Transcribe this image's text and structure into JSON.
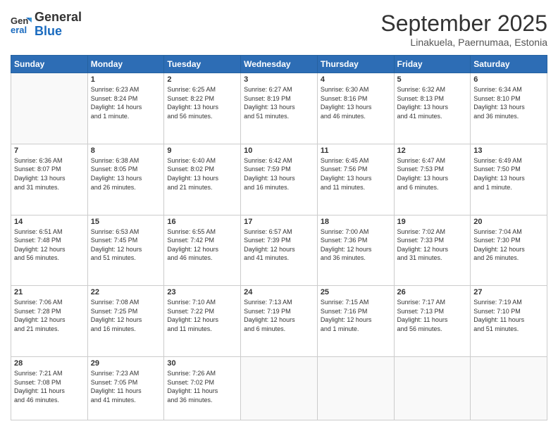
{
  "logo": {
    "line1": "General",
    "line2": "Blue"
  },
  "title": "September 2025",
  "subtitle": "Linakuela, Paernumaa, Estonia",
  "headers": [
    "Sunday",
    "Monday",
    "Tuesday",
    "Wednesday",
    "Thursday",
    "Friday",
    "Saturday"
  ],
  "weeks": [
    [
      {
        "day": "",
        "info": ""
      },
      {
        "day": "1",
        "info": "Sunrise: 6:23 AM\nSunset: 8:24 PM\nDaylight: 14 hours\nand 1 minute."
      },
      {
        "day": "2",
        "info": "Sunrise: 6:25 AM\nSunset: 8:22 PM\nDaylight: 13 hours\nand 56 minutes."
      },
      {
        "day": "3",
        "info": "Sunrise: 6:27 AM\nSunset: 8:19 PM\nDaylight: 13 hours\nand 51 minutes."
      },
      {
        "day": "4",
        "info": "Sunrise: 6:30 AM\nSunset: 8:16 PM\nDaylight: 13 hours\nand 46 minutes."
      },
      {
        "day": "5",
        "info": "Sunrise: 6:32 AM\nSunset: 8:13 PM\nDaylight: 13 hours\nand 41 minutes."
      },
      {
        "day": "6",
        "info": "Sunrise: 6:34 AM\nSunset: 8:10 PM\nDaylight: 13 hours\nand 36 minutes."
      }
    ],
    [
      {
        "day": "7",
        "info": "Sunrise: 6:36 AM\nSunset: 8:07 PM\nDaylight: 13 hours\nand 31 minutes."
      },
      {
        "day": "8",
        "info": "Sunrise: 6:38 AM\nSunset: 8:05 PM\nDaylight: 13 hours\nand 26 minutes."
      },
      {
        "day": "9",
        "info": "Sunrise: 6:40 AM\nSunset: 8:02 PM\nDaylight: 13 hours\nand 21 minutes."
      },
      {
        "day": "10",
        "info": "Sunrise: 6:42 AM\nSunset: 7:59 PM\nDaylight: 13 hours\nand 16 minutes."
      },
      {
        "day": "11",
        "info": "Sunrise: 6:45 AM\nSunset: 7:56 PM\nDaylight: 13 hours\nand 11 minutes."
      },
      {
        "day": "12",
        "info": "Sunrise: 6:47 AM\nSunset: 7:53 PM\nDaylight: 13 hours\nand 6 minutes."
      },
      {
        "day": "13",
        "info": "Sunrise: 6:49 AM\nSunset: 7:50 PM\nDaylight: 13 hours\nand 1 minute."
      }
    ],
    [
      {
        "day": "14",
        "info": "Sunrise: 6:51 AM\nSunset: 7:48 PM\nDaylight: 12 hours\nand 56 minutes."
      },
      {
        "day": "15",
        "info": "Sunrise: 6:53 AM\nSunset: 7:45 PM\nDaylight: 12 hours\nand 51 minutes."
      },
      {
        "day": "16",
        "info": "Sunrise: 6:55 AM\nSunset: 7:42 PM\nDaylight: 12 hours\nand 46 minutes."
      },
      {
        "day": "17",
        "info": "Sunrise: 6:57 AM\nSunset: 7:39 PM\nDaylight: 12 hours\nand 41 minutes."
      },
      {
        "day": "18",
        "info": "Sunrise: 7:00 AM\nSunset: 7:36 PM\nDaylight: 12 hours\nand 36 minutes."
      },
      {
        "day": "19",
        "info": "Sunrise: 7:02 AM\nSunset: 7:33 PM\nDaylight: 12 hours\nand 31 minutes."
      },
      {
        "day": "20",
        "info": "Sunrise: 7:04 AM\nSunset: 7:30 PM\nDaylight: 12 hours\nand 26 minutes."
      }
    ],
    [
      {
        "day": "21",
        "info": "Sunrise: 7:06 AM\nSunset: 7:28 PM\nDaylight: 12 hours\nand 21 minutes."
      },
      {
        "day": "22",
        "info": "Sunrise: 7:08 AM\nSunset: 7:25 PM\nDaylight: 12 hours\nand 16 minutes."
      },
      {
        "day": "23",
        "info": "Sunrise: 7:10 AM\nSunset: 7:22 PM\nDaylight: 12 hours\nand 11 minutes."
      },
      {
        "day": "24",
        "info": "Sunrise: 7:13 AM\nSunset: 7:19 PM\nDaylight: 12 hours\nand 6 minutes."
      },
      {
        "day": "25",
        "info": "Sunrise: 7:15 AM\nSunset: 7:16 PM\nDaylight: 12 hours\nand 1 minute."
      },
      {
        "day": "26",
        "info": "Sunrise: 7:17 AM\nSunset: 7:13 PM\nDaylight: 11 hours\nand 56 minutes."
      },
      {
        "day": "27",
        "info": "Sunrise: 7:19 AM\nSunset: 7:10 PM\nDaylight: 11 hours\nand 51 minutes."
      }
    ],
    [
      {
        "day": "28",
        "info": "Sunrise: 7:21 AM\nSunset: 7:08 PM\nDaylight: 11 hours\nand 46 minutes."
      },
      {
        "day": "29",
        "info": "Sunrise: 7:23 AM\nSunset: 7:05 PM\nDaylight: 11 hours\nand 41 minutes."
      },
      {
        "day": "30",
        "info": "Sunrise: 7:26 AM\nSunset: 7:02 PM\nDaylight: 11 hours\nand 36 minutes."
      },
      {
        "day": "",
        "info": ""
      },
      {
        "day": "",
        "info": ""
      },
      {
        "day": "",
        "info": ""
      },
      {
        "day": "",
        "info": ""
      }
    ]
  ]
}
